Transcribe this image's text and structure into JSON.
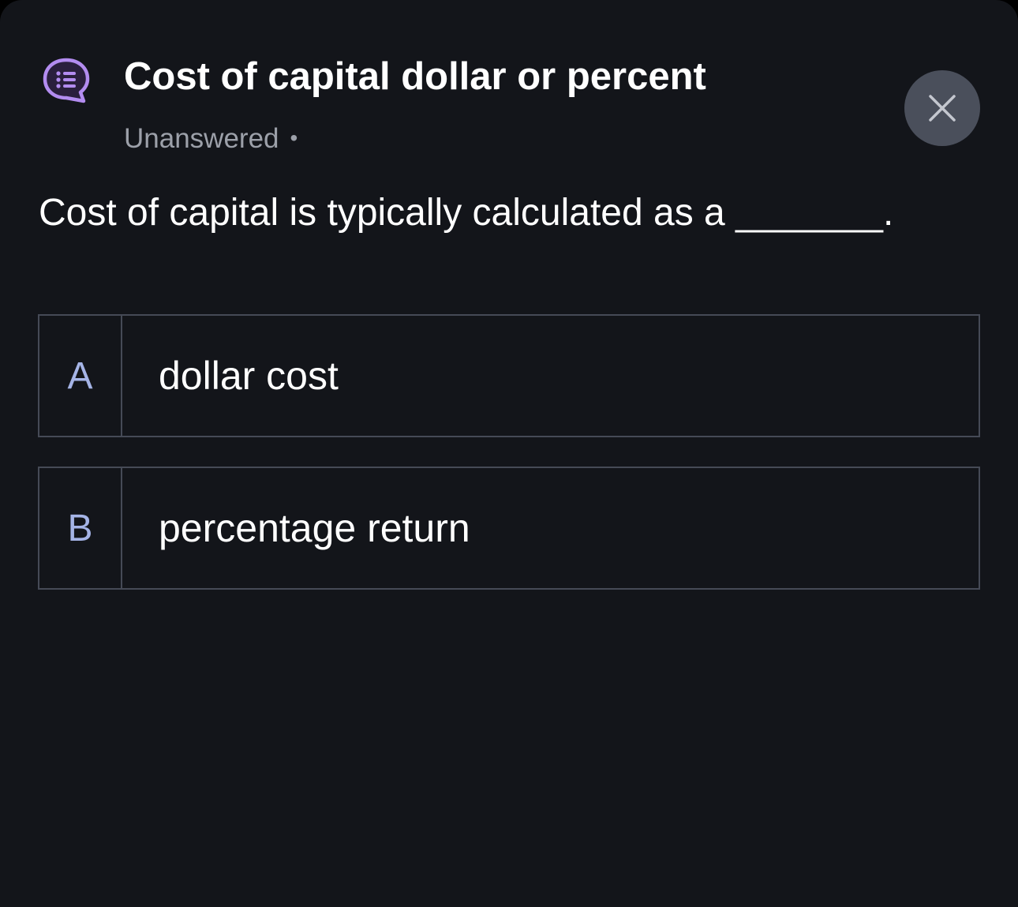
{
  "header": {
    "icon": "chat-list-icon",
    "title": "Cost of capital dollar or percent",
    "status": "Unanswered",
    "status_separator": "•",
    "close_icon": "close-icon"
  },
  "question": {
    "text": "Cost of capital is typically calculated as a _______."
  },
  "options": [
    {
      "letter": "A",
      "text": "dollar cost"
    },
    {
      "letter": "B",
      "text": "percentage return"
    }
  ],
  "colors": {
    "background": "#13151a",
    "accent_icon": "#b38cf0",
    "option_letter": "#a5b4e6",
    "border": "#454a56",
    "close_button": "#4a4f5b",
    "muted_text": "#9ca0a9"
  }
}
